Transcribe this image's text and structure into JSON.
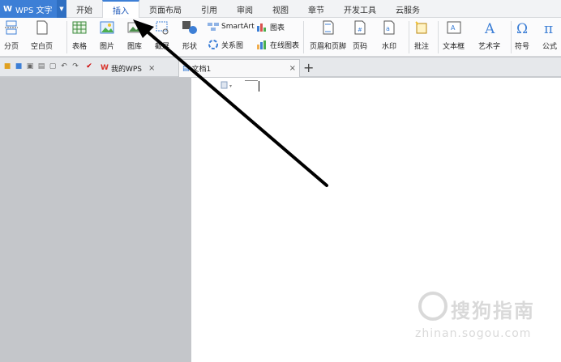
{
  "app": {
    "title": "WPS 文字"
  },
  "menu_tabs": [
    "开始",
    "插入",
    "页面布局",
    "引用",
    "审阅",
    "视图",
    "章节",
    "开发工具",
    "云服务"
  ],
  "active_tab": "插入",
  "ribbon": {
    "page_break": "分页",
    "blank_page": "空白页",
    "table": "表格",
    "picture": "图片",
    "gallery": "图库",
    "screenshot": "截屏",
    "shapes": "形状",
    "smartart": "SmartArt",
    "relation": "关系图",
    "chart": "图表",
    "online_chart": "在线图表",
    "header_footer": "页眉和页脚",
    "page_number": "页码",
    "watermark": "水印",
    "comment": "批注",
    "textbox": "文本框",
    "wordart": "艺术字",
    "symbol": "符号",
    "formula": "公式"
  },
  "doc_tabs": [
    {
      "label": "我的WPS"
    },
    {
      "label": "文档1"
    }
  ],
  "watermark": {
    "title": "搜狗指南",
    "url": "zhinan.sogou.com"
  },
  "colors": {
    "accent": "#3d7fd6",
    "workspace": "#c4c6ca",
    "arrow": "#000000"
  },
  "icons": [
    "page-break-icon",
    "blank-page-icon",
    "table-icon",
    "picture-icon",
    "gallery-icon",
    "screenshot-icon",
    "shapes-icon",
    "smartart-icon",
    "relation-icon",
    "chart-icon",
    "online-chart-icon",
    "header-footer-icon",
    "page-number-icon",
    "watermark-icon",
    "comment-icon",
    "textbox-icon",
    "wordart-icon",
    "symbol-icon",
    "formula-icon"
  ]
}
